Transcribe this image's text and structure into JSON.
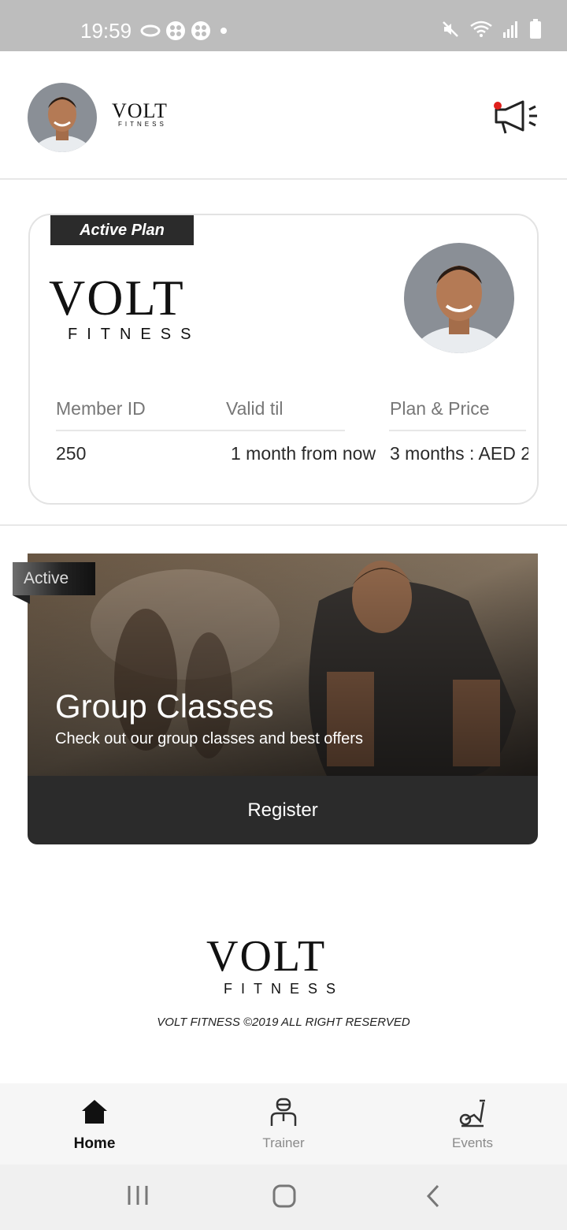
{
  "status_bar": {
    "time": "19:59"
  },
  "header": {
    "brand_small": "VOLT",
    "brand_small_sub": "FITNESS"
  },
  "plan_card": {
    "tag": "Active Plan",
    "brand": "VOLT",
    "brand_sub": "FITNESS",
    "columns": [
      "Member ID",
      "Valid til",
      "Plan & Price"
    ],
    "values": [
      "250",
      "1 month from now",
      "3 months : AED 2"
    ]
  },
  "class_card": {
    "ribbon": "Active",
    "title": "Group Classes",
    "subtitle": "Check out our group classes and best offers",
    "button": "Register"
  },
  "footer": {
    "brand": "VOLT",
    "brand_sub": "FITNESS",
    "copyright": "VOLT FITNESS ©2019 ALL RIGHT RESERVED"
  },
  "bottom_nav": {
    "items": [
      {
        "label": "Home",
        "icon": "home-icon",
        "active": true
      },
      {
        "label": "Trainer",
        "icon": "trainer-icon",
        "active": false
      },
      {
        "label": "Events",
        "icon": "bike-icon",
        "active": false
      }
    ]
  },
  "colors": {
    "dark": "#2b2b2b",
    "notification": "#e0201c",
    "status_bar": "#bdbdbd"
  }
}
